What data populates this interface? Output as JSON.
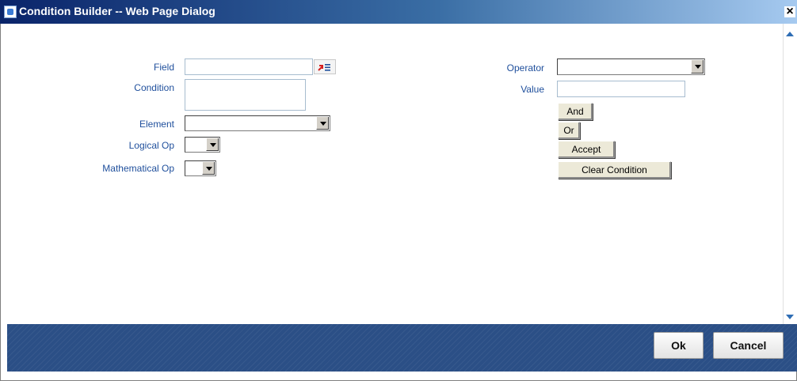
{
  "window": {
    "title": "Condition Builder -- Web Page Dialog",
    "close_glyph": "×"
  },
  "form": {
    "field_label": "Field",
    "field_value": "",
    "condition_label": "Condition",
    "condition_value": "",
    "element_label": "Element",
    "element_value": "",
    "logical_op_label": "Logical Op",
    "logical_op_value": "",
    "mathematical_op_label": "Mathematical Op",
    "mathematical_op_value": "",
    "operator_label": "Operator",
    "operator_value": "",
    "value_label": "Value",
    "value_value": ""
  },
  "buttons": {
    "and": "And",
    "or": "Or",
    "accept": "Accept",
    "clear_condition": "Clear Condition",
    "ok": "Ok",
    "cancel": "Cancel"
  },
  "icons": {
    "window": "app-window-icon",
    "lov": "list-of-values-icon",
    "close": "close-icon"
  },
  "colors": {
    "title_bar": "#0a246a",
    "label_text": "#1f4f9c",
    "footer": "#2b4f86"
  }
}
